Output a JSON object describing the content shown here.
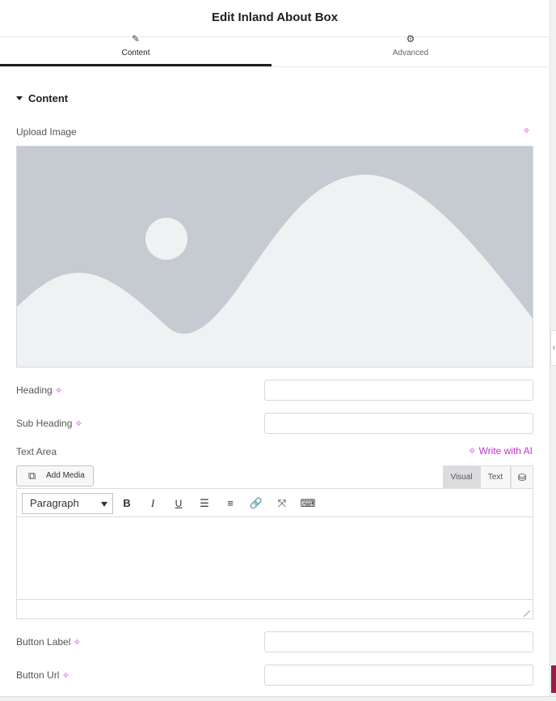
{
  "header": {
    "title": "Edit Inland About Box"
  },
  "tabs": [
    {
      "label": "Content",
      "icon": "pencil-icon"
    },
    {
      "label": "Advanced",
      "icon": "gear-icon"
    }
  ],
  "section": {
    "title": "Content"
  },
  "upload_image": {
    "label": "Upload Image"
  },
  "fields": {
    "heading": {
      "label": "Heading",
      "value": ""
    },
    "sub_heading": {
      "label": "Sub Heading",
      "value": ""
    },
    "button_label": {
      "label": "Button Label",
      "value": ""
    },
    "button_url": {
      "label": "Button Url",
      "value": ""
    }
  },
  "text_area": {
    "label": "Text Area",
    "write_with_ai": "Write with AI",
    "add_media": "Add Media",
    "editor_tabs": [
      "Visual",
      "Text"
    ],
    "format": "Paragraph",
    "toolbar_icons": [
      "bold-icon",
      "italic-icon",
      "underline-icon",
      "bullet-list-icon",
      "numbered-list-icon",
      "link-icon",
      "fullscreen-icon",
      "keyboard-icon"
    ],
    "content": ""
  },
  "colors": {
    "ai_accent": "#c036c8",
    "active_tab_bar": "#1f1f1f",
    "placeholder_bg": "#c5cbd0",
    "placeholder_fg": "#f0f1f3"
  }
}
